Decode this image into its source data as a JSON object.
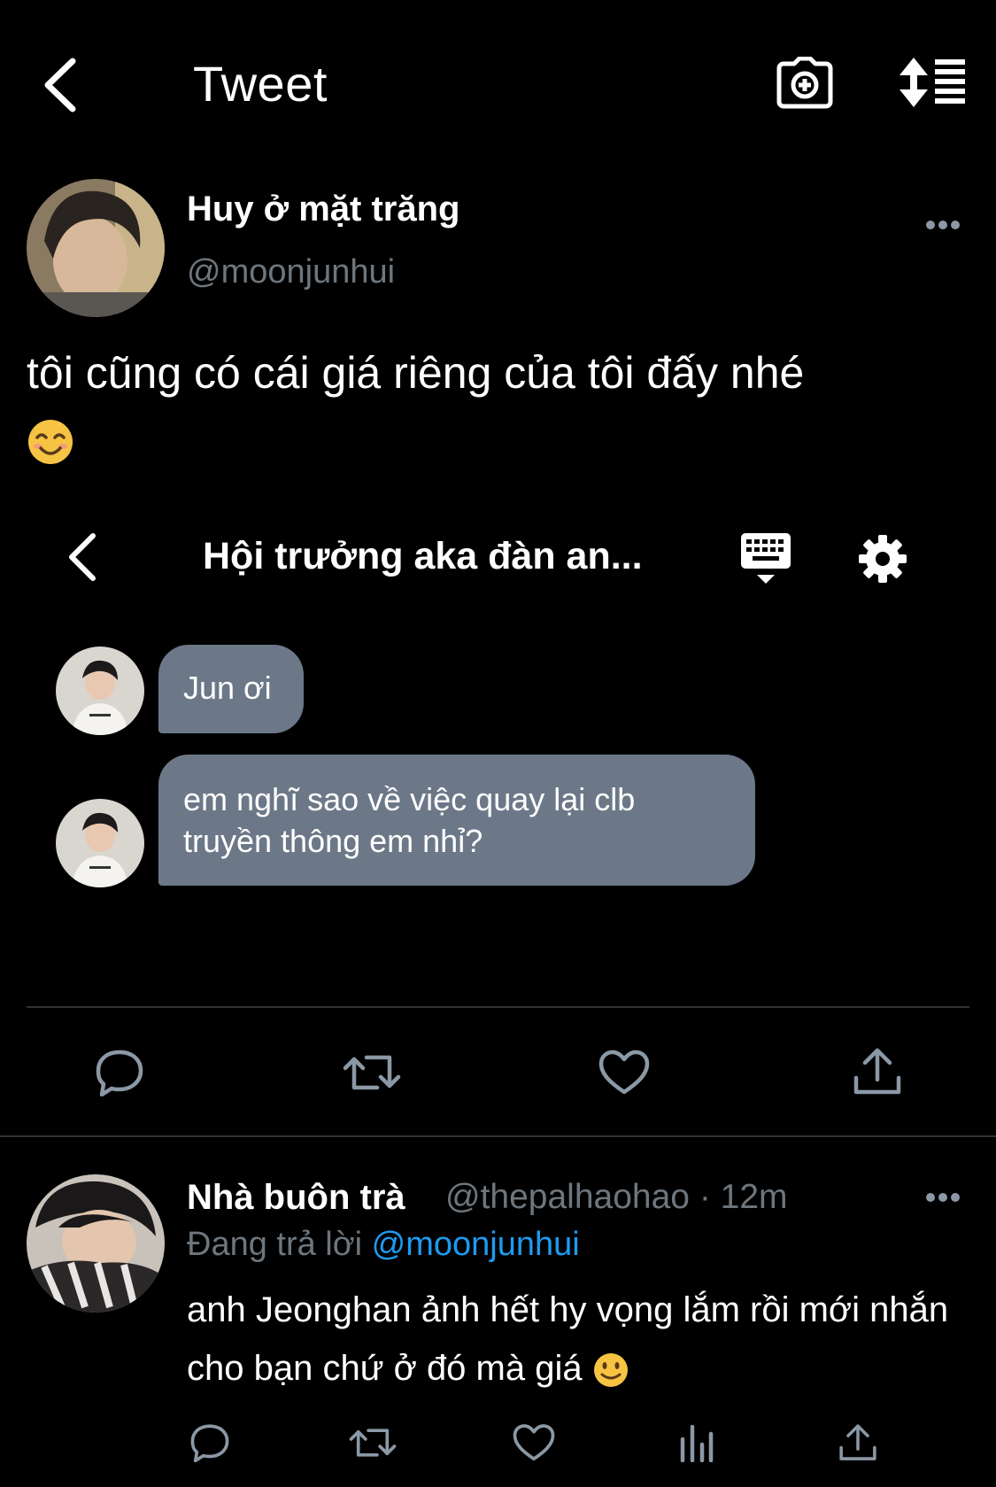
{
  "header": {
    "title": "Tweet"
  },
  "tweet": {
    "author_name": "Huy ở mặt trăng",
    "author_handle": "@moonjunhui",
    "text": "tôi cũng có cái giá riêng của tôi đấy nhé",
    "emoji": "smiling-face-with-smiling-eyes"
  },
  "embedded_screenshot": {
    "title": "Hội trưởng aka đàn an...",
    "messages": [
      {
        "text": "Jun ơi"
      },
      {
        "text": "em nghĩ sao về việc quay lại clb truyền thông em nhỉ?"
      }
    ]
  },
  "reply": {
    "name": "Nhà buôn trà",
    "handle": "@thepalhaohao",
    "separator": " · ",
    "time": "12m",
    "replying_label": "Đang trả lời",
    "replying_to": "@moonjunhui",
    "text": "anh Jeonghan ảnh hết hy vọng lắm rồi mới nhắn cho bạn chứ ở đó mà giá",
    "emoji": "slightly-smiling-face"
  },
  "colors": {
    "background": "#000000",
    "secondary_text": "#6e767d",
    "link": "#1d9bf0",
    "bubble": "#6c7888",
    "divider": "#2f3336"
  }
}
